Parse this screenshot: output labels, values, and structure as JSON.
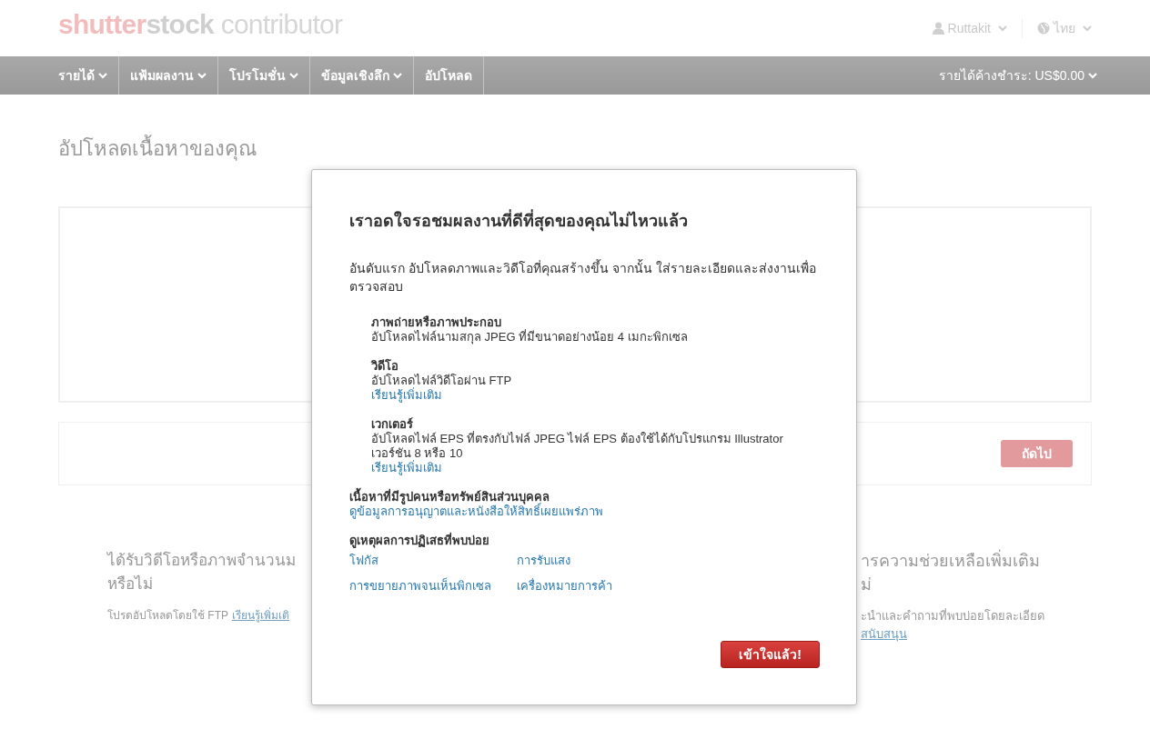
{
  "header": {
    "logo": {
      "brand_a": "shutter",
      "brand_b": "stock",
      "product": "contributor"
    },
    "user": "Ruttakit",
    "language": "ไทย"
  },
  "nav": {
    "items": [
      {
        "label": "รายได้",
        "dropdown": true
      },
      {
        "label": "แฟ้มผลงาน",
        "dropdown": true
      },
      {
        "label": "โปรโมชั่น",
        "dropdown": true
      },
      {
        "label": "ข้อมูลเชิงลึก",
        "dropdown": true
      },
      {
        "label": "อัปโหลด",
        "dropdown": false
      }
    ],
    "earnings": "รายได้ค้างชำระ: US$0.00"
  },
  "page": {
    "title": "อัปโหลดเนื้อหาของคุณ",
    "next_button": {
      "label": "ถัดไป",
      "disabled": true
    },
    "help_left": {
      "heading": [
        "ได้รับวิดีโอหรือภาพจำนวนม",
        "หรือไม่"
      ],
      "text": "โปรดอัปโหลดโดยใช้ FTP",
      "link": "เรียนรู้เพิ่มเติ"
    },
    "help_right": {
      "heading": [
        "ารความช่วยเหลือเพิ่มเติม",
        "ม่"
      ],
      "text": "ะนำและคำถามที่พบบ่อยโดยละเอียด",
      "link": "สนับสนุน"
    }
  },
  "modal": {
    "title": "เราอดใจรอชมผลงานที่ดีที่สุดของคุณไม่ไหวแล้ว",
    "intro": "อันดับแรก อัปโหลดภาพและวิดีโอที่คุณสร้างขึ้น จากนั้น ใส่รายละเอียดและส่งงานเพื่อตรวจสอบ",
    "types": [
      {
        "heading": "ภาพถ่ายหรือภาพประกอบ",
        "text": "อัปโหลดไฟล์นามสกุล JPEG ที่มีขนาดอย่างน้อย 4 เมกะพิกเซล"
      },
      {
        "heading": "วิดีโอ",
        "text": "อัปโหลดไฟล์วิดีโอผ่าน FTP",
        "link": "เรียนรู้เพิ่มเติม"
      },
      {
        "heading": "เวกเตอร์",
        "text": "อัปโหลดไฟล์ EPS ที่ตรงกับไฟล์ JPEG ไฟล์ EPS ต้องใช้ได้กับโปรแกรม Illustrator เวอร์ชัน 8 หรือ 10",
        "link": "เรียนรู้เพิ่มเติม"
      }
    ],
    "releases": {
      "heading": "เนื้อหาที่มีรูปคนหรือทรัพย์สินส่วนบุคคล",
      "link": "ดูข้อมูลการอนุญาตและหนังสือให้สิทธิ์เผยแพร่ภาพ"
    },
    "rejections": {
      "heading": "ดูเหตุผลการปฏิเสธที่พบบ่อย",
      "links": [
        "โฟกัส",
        "การรับแสง",
        "การขยายภาพจนเห็นพิกเซล",
        "เครื่องหมายการค้า"
      ]
    },
    "button": "เข้าใจแล้ว!"
  }
}
